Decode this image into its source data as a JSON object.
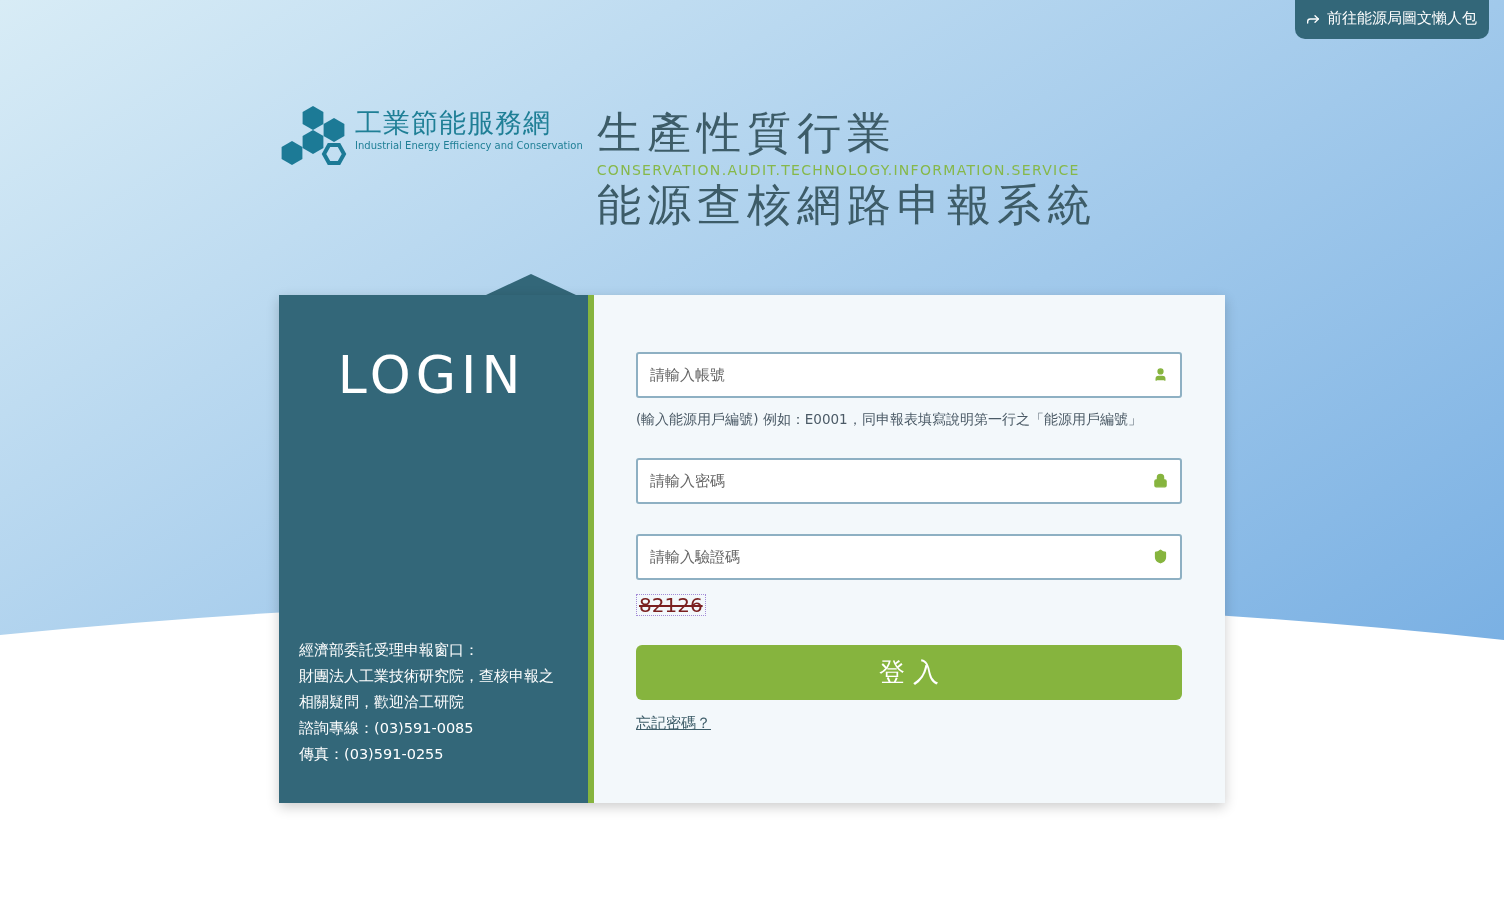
{
  "top_link": {
    "label": "前往能源局圖文懶人包"
  },
  "logo": {
    "title": "工業節能服務網",
    "subtitle": "Industrial Energy Efficiency and Conservation"
  },
  "header": {
    "line_1": "生產性質行業",
    "tagline": "CONSERVATION.AUDIT.TECHNOLOGY.INFORMATION.SERVICE",
    "line_2": "能源查核網路申報系統"
  },
  "login_panel": {
    "title": "LOGIN",
    "contact_lines": [
      "經濟部委託受理申報窗口：",
      "財團法人工業技術研究院，查核申報之相關疑問，歡迎洽工研院",
      "諮詢專線：(03)591-0085",
      "傳真：(03)591-0255"
    ]
  },
  "form": {
    "fields": [
      {
        "kind": "account",
        "placeholder": "請輸入帳號",
        "hint": "(輸入能源用戶編號) 例如：E0001，同申報表填寫說明第一行之「能源用戶編號」"
      },
      {
        "kind": "password",
        "placeholder": "請輸入密碼"
      },
      {
        "kind": "captcha",
        "placeholder": "請輸入驗證碼"
      }
    ],
    "captcha_code": "82126",
    "submit": "登 入",
    "forgot_link": "忘記密碼？"
  }
}
